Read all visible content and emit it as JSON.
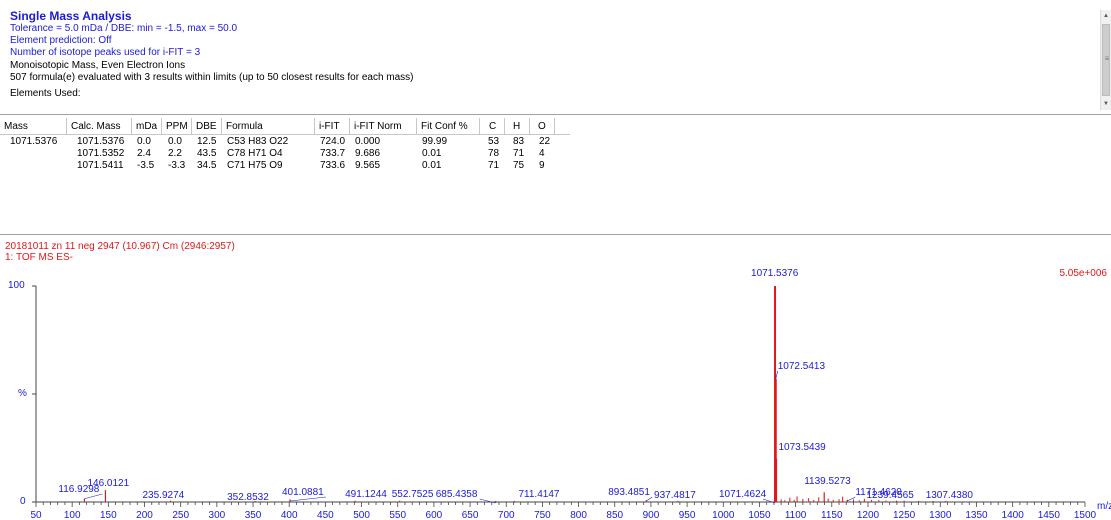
{
  "header": {
    "title": "Single Mass Analysis",
    "tolerance_line": "Tolerance = 5.0 mDa   /   DBE: min = -1.5, max = 50.0",
    "element_prediction": "Element prediction: Off",
    "isotope_peaks": "Number of isotope peaks used for i-FIT = 3",
    "monoisotopic": "Monoisotopic Mass, Even Electron Ions",
    "formulae_evaluated": "507 formula(e) evaluated with 3 results within limits (up to 50 closest results for each mass)",
    "elements_used": "Elements Used:"
  },
  "table": {
    "headers": [
      "Mass",
      "Calc. Mass",
      "mDa",
      "PPM",
      "DBE",
      "Formula",
      "i-FIT",
      "i-FIT Norm",
      "Fit Conf %",
      "C",
      "H",
      "O"
    ],
    "rows": [
      {
        "mass": "1071.5376",
        "calc": "1071.5376",
        "mda": "0.0",
        "ppm": "0.0",
        "dbe": "12.5",
        "formula": "C53  H83  O22",
        "ifit": "724.0",
        "ifitnorm": "0.000",
        "fitconf": "99.99",
        "c": "53",
        "h": "83",
        "o": "22"
      },
      {
        "mass": "",
        "calc": "1071.5352",
        "mda": "2.4",
        "ppm": "2.2",
        "dbe": "43.5",
        "formula": "C78  H71  O4",
        "ifit": "733.7",
        "ifitnorm": "9.686",
        "fitconf": "0.01",
        "c": "78",
        "h": "71",
        "o": "4"
      },
      {
        "mass": "",
        "calc": "1071.5411",
        "mda": "-3.5",
        "ppm": "-3.3",
        "dbe": "34.5",
        "formula": "C71  H75  O9",
        "ifit": "733.6",
        "ifitnorm": "9.565",
        "fitconf": "0.01",
        "c": "71",
        "h": "75",
        "o": "9"
      }
    ]
  },
  "spectrum": {
    "title": "20181011 zn 11 neg 2947 (10.967) Cm (2946:2957)",
    "subtitle": "1: TOF MS ES-",
    "max_intensity": "5.05e+006",
    "y_top_label": "100",
    "y_mid_label": "%",
    "y_bottom_label": "0",
    "x_unit": "m/z"
  },
  "chart_data": {
    "type": "bar",
    "xlabel": "m/z",
    "ylabel": "%",
    "xlim": [
      50,
      1500
    ],
    "ylim": [
      0,
      100
    ],
    "x_ticks": [
      50,
      100,
      150,
      200,
      250,
      300,
      350,
      400,
      450,
      500,
      550,
      600,
      650,
      700,
      750,
      800,
      850,
      900,
      950,
      1000,
      1050,
      1100,
      1150,
      1200,
      1250,
      1300,
      1350,
      1400,
      1450,
      1500
    ],
    "labeled_peaks": [
      {
        "mz": 116.9298,
        "label": "116.9298",
        "intensity": 1.5
      },
      {
        "mz": 146.0121,
        "label": "146.0121",
        "intensity": 5.5
      },
      {
        "mz": 235.9274,
        "label": "235.9274",
        "intensity": 0.6
      },
      {
        "mz": 352.8532,
        "label": "352.8532",
        "intensity": 0.5
      },
      {
        "mz": 401.0881,
        "label": "401.0881",
        "intensity": 1.2
      },
      {
        "mz": 491.1244,
        "label": "491.1244",
        "intensity": 0.6
      },
      {
        "mz": 552.7525,
        "label": "552.7525",
        "intensity": 0.6
      },
      {
        "mz": 685.4358,
        "label": "685.4358",
        "intensity": 0.5
      },
      {
        "mz": 711.4147,
        "label": "711.4147",
        "intensity": 0.5
      },
      {
        "mz": 893.4851,
        "label": "893.4851",
        "intensity": 0.8
      },
      {
        "mz": 937.4817,
        "label": "937.4817",
        "intensity": 0.5
      },
      {
        "mz": 1071.4624,
        "label": "1071.4624",
        "intensity": 0.8
      },
      {
        "mz": 1071.5376,
        "label": "1071.5376",
        "intensity": 100
      },
      {
        "mz": 1072.5413,
        "label": "1072.5413",
        "intensity": 57
      },
      {
        "mz": 1073.5439,
        "label": "1073.5439",
        "intensity": 20
      },
      {
        "mz": 1139.5273,
        "label": "1139.5273",
        "intensity": 4.5
      },
      {
        "mz": 1171.462,
        "label": "1171.4620",
        "intensity": 1.0
      },
      {
        "mz": 1239.4565,
        "label": "1239.4565",
        "intensity": 0.6
      },
      {
        "mz": 1307.438,
        "label": "1307.4380",
        "intensity": 0.5
      }
    ]
  },
  "colors": {
    "header_blue": "#1a1ad8",
    "spectrum_red": "#e01818",
    "axis_blue": "#1a1ad8"
  }
}
